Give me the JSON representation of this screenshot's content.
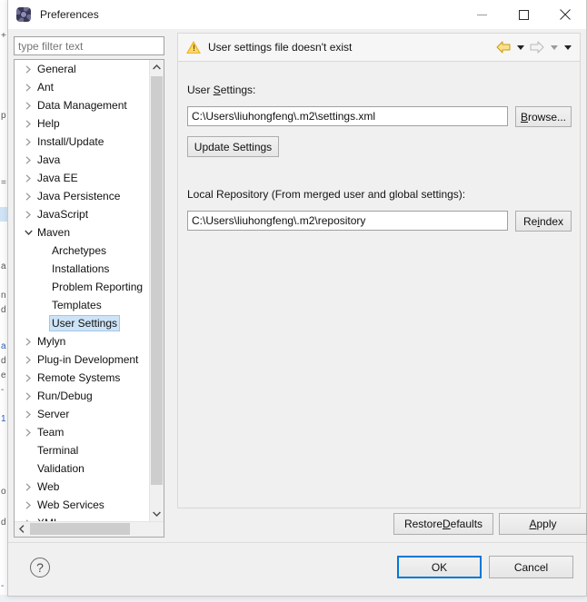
{
  "window": {
    "title": "Preferences",
    "icon": "preferences-gear-icon",
    "controls": {
      "minimize": "minimize-icon",
      "maximize": "maximize-icon",
      "close": "close-icon"
    }
  },
  "filter": {
    "placeholder": "type filter text",
    "value": ""
  },
  "tree": {
    "items": [
      {
        "label": "General",
        "level": 0,
        "state": "collapsed",
        "selected": false
      },
      {
        "label": "Ant",
        "level": 0,
        "state": "collapsed",
        "selected": false
      },
      {
        "label": "Data Management",
        "level": 0,
        "state": "collapsed",
        "selected": false
      },
      {
        "label": "Help",
        "level": 0,
        "state": "collapsed",
        "selected": false
      },
      {
        "label": "Install/Update",
        "level": 0,
        "state": "collapsed",
        "selected": false
      },
      {
        "label": "Java",
        "level": 0,
        "state": "collapsed",
        "selected": false
      },
      {
        "label": "Java EE",
        "level": 0,
        "state": "collapsed",
        "selected": false
      },
      {
        "label": "Java Persistence",
        "level": 0,
        "state": "collapsed",
        "selected": false
      },
      {
        "label": "JavaScript",
        "level": 0,
        "state": "collapsed",
        "selected": false
      },
      {
        "label": "Maven",
        "level": 0,
        "state": "expanded",
        "selected": false
      },
      {
        "label": "Archetypes",
        "level": 1,
        "state": "leaf",
        "selected": false
      },
      {
        "label": "Installations",
        "level": 1,
        "state": "leaf",
        "selected": false
      },
      {
        "label": "Problem Reporting",
        "level": 1,
        "state": "leaf",
        "selected": false
      },
      {
        "label": "Templates",
        "level": 1,
        "state": "leaf",
        "selected": false
      },
      {
        "label": "User Settings",
        "level": 1,
        "state": "leaf",
        "selected": true
      },
      {
        "label": "Mylyn",
        "level": 0,
        "state": "collapsed",
        "selected": false
      },
      {
        "label": "Plug-in Development",
        "level": 0,
        "state": "collapsed",
        "selected": false
      },
      {
        "label": "Remote Systems",
        "level": 0,
        "state": "collapsed",
        "selected": false
      },
      {
        "label": "Run/Debug",
        "level": 0,
        "state": "collapsed",
        "selected": false
      },
      {
        "label": "Server",
        "level": 0,
        "state": "collapsed",
        "selected": false
      },
      {
        "label": "Team",
        "level": 0,
        "state": "collapsed",
        "selected": false
      },
      {
        "label": "Terminal",
        "level": 0,
        "state": "leaf",
        "selected": false
      },
      {
        "label": "Validation",
        "level": 0,
        "state": "leaf",
        "selected": false
      },
      {
        "label": "Web",
        "level": 0,
        "state": "collapsed",
        "selected": false
      },
      {
        "label": "Web Services",
        "level": 0,
        "state": "collapsed",
        "selected": false
      },
      {
        "label": "XML",
        "level": 0,
        "state": "collapsed",
        "selected": false
      }
    ],
    "scrollbars": {
      "vertical_up": "scroll-up-icon",
      "vertical_down": "scroll-down-icon",
      "horizontal_left": "scroll-left-icon",
      "horizontal_right": "scroll-right-icon"
    }
  },
  "page": {
    "header": {
      "icon": "warning-icon",
      "title": "User settings file doesn't exist",
      "nav": {
        "back": "back-arrow-icon",
        "back_menu": "back-dropdown-icon",
        "forward": "forward-arrow-icon",
        "forward_menu": "forward-dropdown-icon",
        "view_menu": "view-menu-dropdown-icon"
      }
    },
    "user_settings": {
      "label_pre": "User ",
      "label_mnemonic": "S",
      "label_post": "ettings:",
      "value": "C:\\Users\\liuhongfeng\\.m2\\settings.xml",
      "browse_pre": "",
      "browse_mnemonic": "B",
      "browse_post": "rowse...",
      "update_label": "Update Settings"
    },
    "local_repository": {
      "label": "Local Repository (From merged user and global settings):",
      "value": "C:\\Users\\liuhongfeng\\.m2\\repository",
      "reindex_pre": "Re",
      "reindex_mnemonic": "i",
      "reindex_post": "ndex"
    },
    "actions": {
      "restore_pre": "Restore ",
      "restore_mnemonic": "D",
      "restore_post": "efaults",
      "apply_pre": "",
      "apply_mnemonic": "A",
      "apply_post": "pply"
    }
  },
  "footer": {
    "help": "?",
    "ok": "OK",
    "cancel": "Cancel"
  },
  "background": {
    "fragments": [
      "+",
      "p",
      "=",
      "a",
      "n",
      "d",
      "a",
      "d",
      "e",
      "-",
      "1",
      "o",
      "d",
      "-"
    ]
  },
  "colors": {
    "accent": "#0078d7",
    "selection": "#cde4f7",
    "warning": "#f0b429",
    "dialog_bg": "#f0f0f0"
  }
}
